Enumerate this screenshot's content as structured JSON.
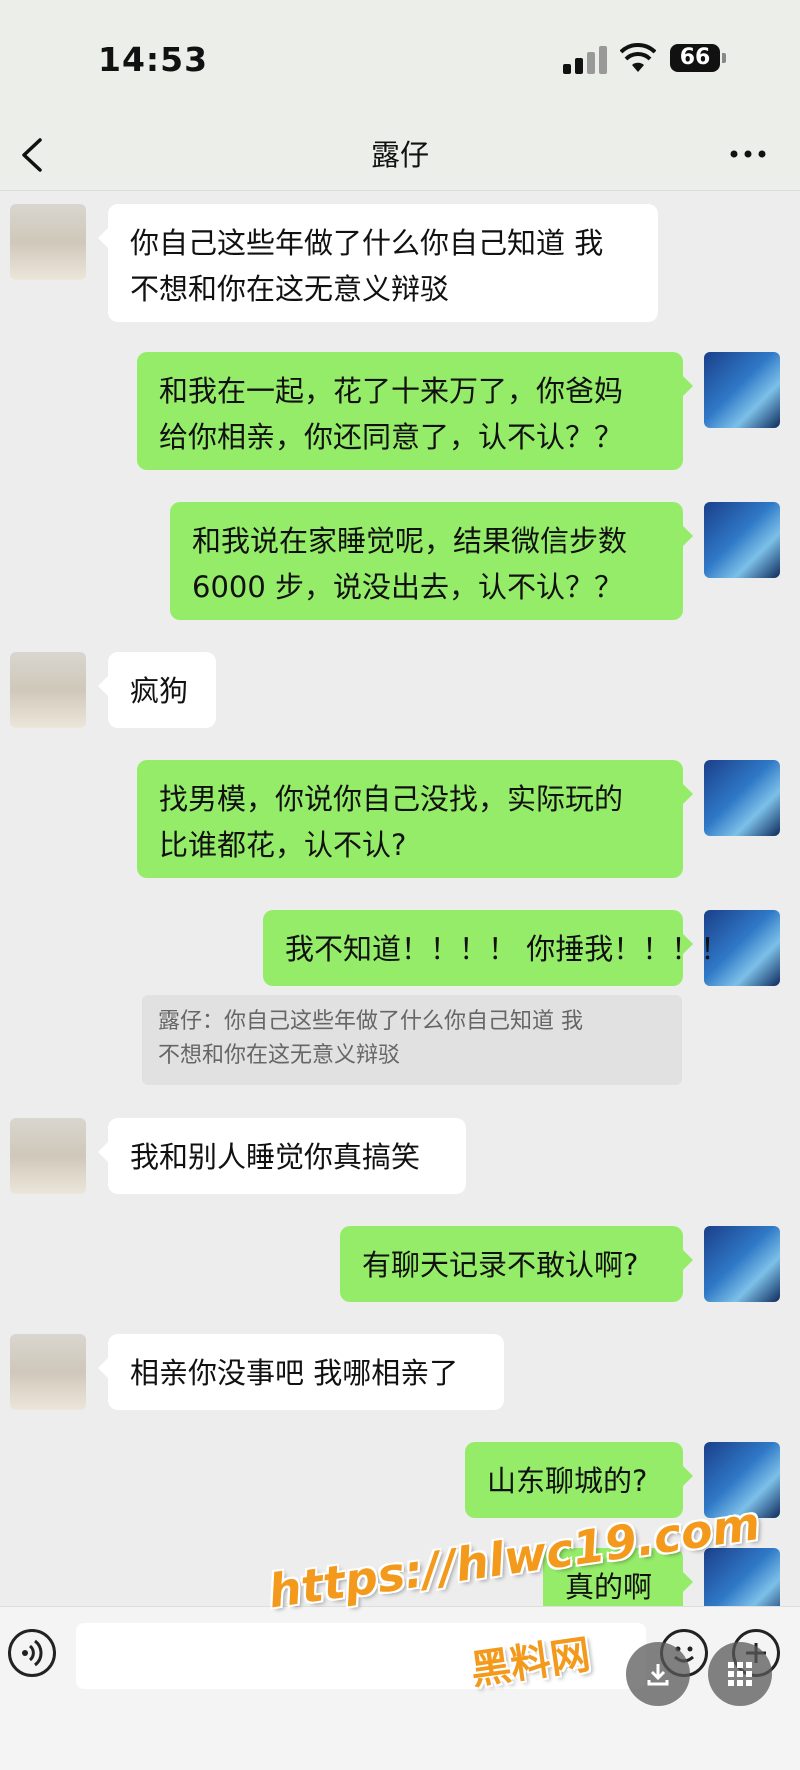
{
  "status": {
    "time": "14:53",
    "battery": "66"
  },
  "header": {
    "title": "露仔"
  },
  "messages": [
    {
      "side": "left",
      "lines": [
        "你自己这些年做了什么你自己知道 我",
        "不想和你在这无意义辩驳"
      ]
    },
    {
      "side": "right",
      "lines": [
        "和我在一起，花了十来万了，你爸妈",
        "给你相亲，你还同意了，认不认？？"
      ]
    },
    {
      "side": "right",
      "lines": [
        "和我说在家睡觉呢，结果微信步数",
        "6000 步，说没出去，认不认？？"
      ]
    },
    {
      "side": "left",
      "lines": [
        "疯狗"
      ]
    },
    {
      "side": "right",
      "lines": [
        "找男模，你说你自己没找，实际玩的",
        "比谁都花，认不认?"
      ]
    },
    {
      "side": "right",
      "lines": [
        "我不知道！！！！ 你捶我！！！！"
      ]
    },
    {
      "side": "left",
      "lines": [
        "我和别人睡觉你真搞笑"
      ]
    },
    {
      "side": "right",
      "lines": [
        "有聊天记录不敢认啊?"
      ]
    },
    {
      "side": "left",
      "lines": [
        "相亲你没事吧 我哪相亲了"
      ]
    },
    {
      "side": "right",
      "lines": [
        "山东聊城的?"
      ]
    },
    {
      "side": "right",
      "lines": [
        "真的啊"
      ]
    }
  ],
  "quote": {
    "lines": [
      "露仔：你自己这些年做了什么你自己知道 我",
      "不想和你在这无意义辩驳"
    ]
  },
  "watermark": {
    "url": "https://hlwc19.com",
    "name": "黑料网"
  },
  "colors": {
    "sent_bubble": "#95ec69",
    "received_bubble": "#ffffff",
    "watermark": "#f39a1c"
  }
}
